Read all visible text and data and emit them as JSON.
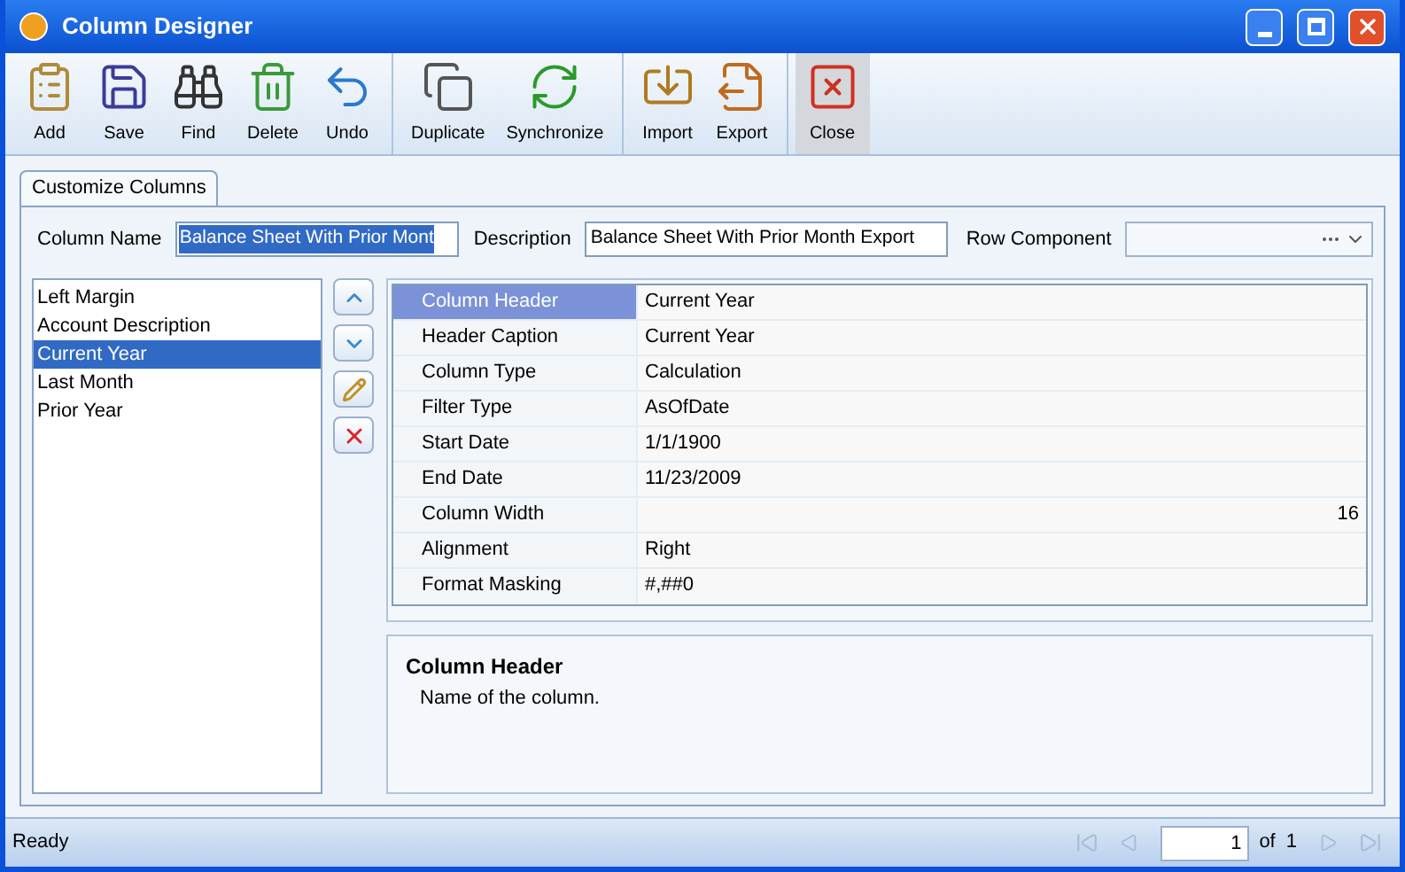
{
  "window": {
    "title": "Column Designer"
  },
  "toolbar": [
    [
      {
        "label": "Add",
        "active": false
      },
      {
        "label": "Save",
        "active": false
      },
      {
        "label": "Find",
        "active": false
      },
      {
        "label": "Delete",
        "active": false
      },
      {
        "label": "Undo",
        "active": false
      }
    ],
    [
      {
        "label": "Duplicate",
        "active": false
      },
      {
        "label": "Synchronize",
        "active": false
      }
    ],
    [
      {
        "label": "Import",
        "active": false
      },
      {
        "label": "Export",
        "active": false
      }
    ],
    [
      {
        "label": "Close",
        "active": true
      }
    ]
  ],
  "tabs": [
    {
      "label": "Customize Columns",
      "selected": true
    }
  ],
  "fields": {
    "column_name": {
      "label": "Column Name",
      "value": "Balance Sheet With Prior Mont",
      "text_selected": true
    },
    "description": {
      "label": "Description",
      "value": "Balance Sheet With Prior Month Export"
    },
    "row_component": {
      "label": "Row Component"
    }
  },
  "columns": [
    {
      "label": "Left Margin",
      "selected": false
    },
    {
      "label": "Account Description",
      "selected": false
    },
    {
      "label": "Current Year",
      "selected": true
    },
    {
      "label": "Last Month",
      "selected": false
    },
    {
      "label": "Prior Year",
      "selected": false
    }
  ],
  "properties": [
    {
      "name": "Column Header",
      "value": "Current Year",
      "selected": true,
      "kind": "text"
    },
    {
      "name": "Header Caption",
      "value": "Current Year",
      "selected": false,
      "kind": "text"
    },
    {
      "name": "Column Type",
      "value": "Calculation",
      "selected": false,
      "kind": "text"
    },
    {
      "name": "Filter Type",
      "value": "AsOfDate",
      "selected": false,
      "kind": "text"
    },
    {
      "name": "Start Date",
      "value": "1/1/1900",
      "selected": false,
      "kind": "text"
    },
    {
      "name": "End Date",
      "value": "11/23/2009",
      "selected": false,
      "kind": "text"
    },
    {
      "name": "Column Width",
      "value": "16",
      "selected": false,
      "kind": "number"
    },
    {
      "name": "Alignment",
      "value": "Right",
      "selected": false,
      "kind": "text"
    },
    {
      "name": "Format Masking",
      "value": "#,##0",
      "selected": false,
      "kind": "text"
    }
  ],
  "help": {
    "title": "Column Header",
    "text": "Name of the column."
  },
  "status_bar": {
    "text": "Ready",
    "page": "1",
    "of_label": "of",
    "total": "1"
  }
}
